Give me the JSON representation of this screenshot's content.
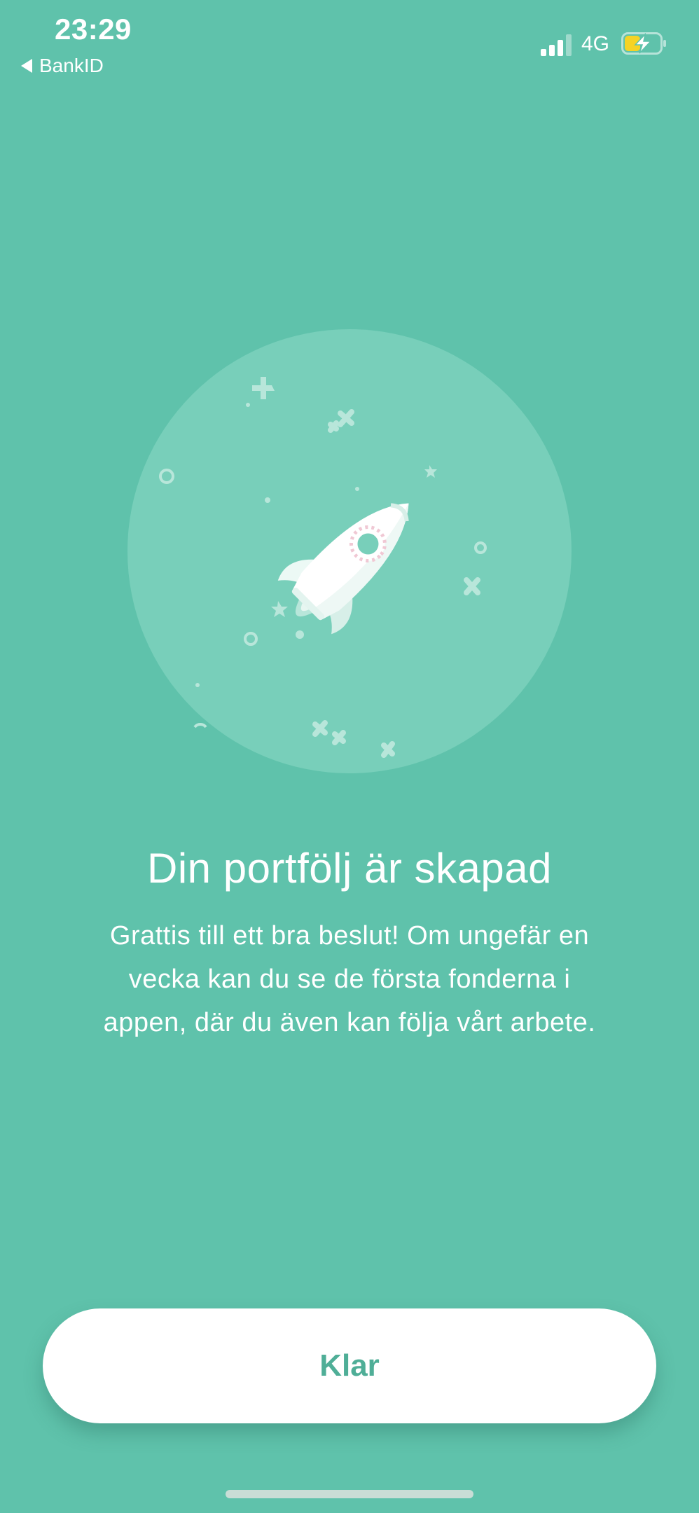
{
  "status_bar": {
    "time": "23:29",
    "back_label": "BankID",
    "network": "4G",
    "battery_icon": "battery-charging-icon",
    "charging_color": "#f5d326"
  },
  "hero": {
    "icon": "rocket-icon",
    "circle_color": "#78cfba"
  },
  "content": {
    "title": "Din portfölj är skapad",
    "body_lines": [
      "Grattis till ett bra beslut! Om ungefär en",
      "vecka kan du se de första fonderna i",
      "appen, där du även kan följa vårt arbete."
    ]
  },
  "actions": {
    "done_label": "Klar"
  },
  "colors": {
    "background": "#5fc2ab",
    "accent": "#4fae97",
    "button_bg": "#ffffff"
  }
}
